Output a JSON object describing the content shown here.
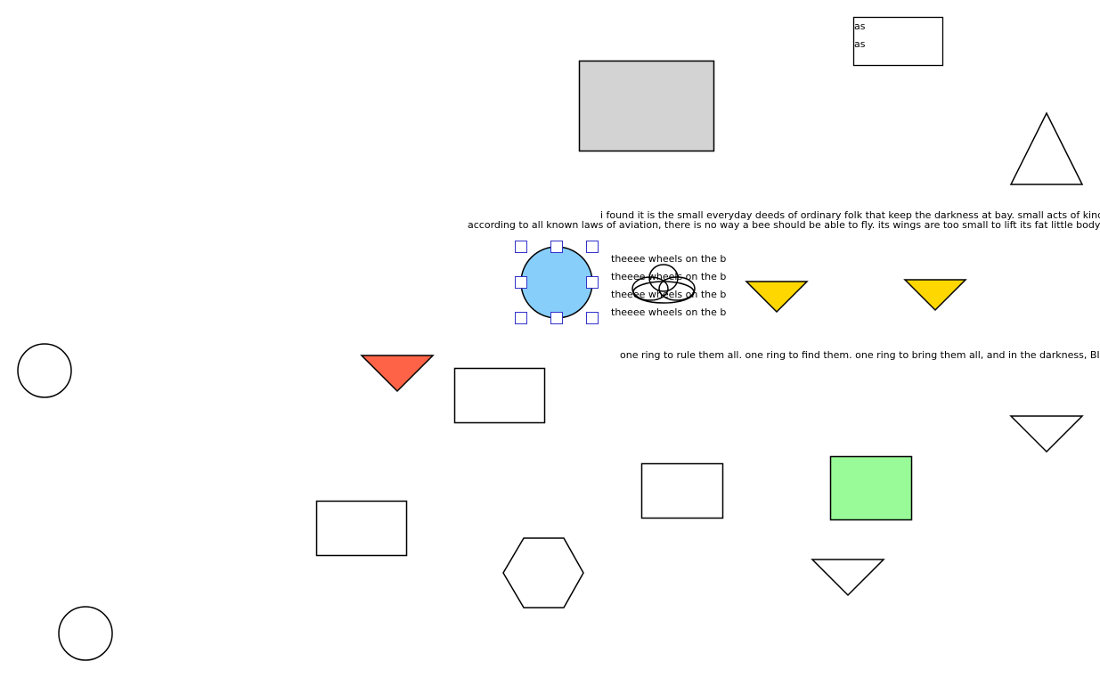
{
  "canvas": {
    "background": "#ffffff",
    "stroke": "#000000"
  },
  "colors": {
    "gray": "#d3d3d3",
    "blue": "#87cefa",
    "yellow": "#ffd700",
    "red": "#ff6347",
    "green": "#98fb98",
    "white": "#ffffff",
    "handle_stroke": "#3333cc"
  },
  "text_box": {
    "line1": "as",
    "line2": "as"
  },
  "text_lines": {
    "darkness": "i found it is the small everyday deeds of ordinary folk that keep the darkness at bay. small acts of kindness an",
    "aviation": "according to all known laws of aviation, there is no way a bee should be able to fly. its wings are too small to lift its fat little body off the g",
    "ring": "one ring to rule them all. one ring to find them. one ring to bring them all, and in the darkness, BIND the"
  },
  "wheels": [
    "theeee wheels on the b",
    "theeee wheels on the b",
    "theeee wheels on the b",
    "theeee wheels on the b"
  ],
  "selection": {
    "selected_shape": "blue-circle",
    "handles": [
      "top-left",
      "top",
      "top-right",
      "left",
      "right",
      "bottom-left",
      "bottom",
      "bottom-right"
    ]
  }
}
